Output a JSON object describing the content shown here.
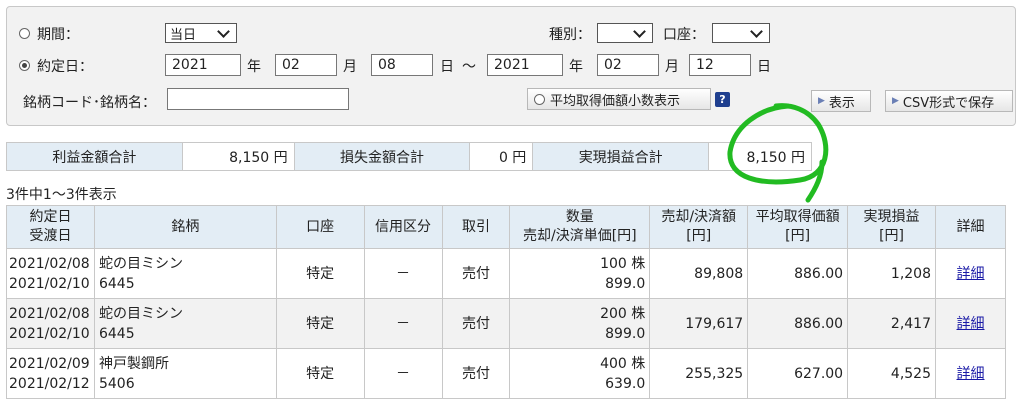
{
  "search": {
    "period_label": "期間：",
    "period_select": "当日",
    "trade_date_label": "約定日：",
    "from_year": "2021",
    "year_label": "年",
    "from_month": "02",
    "month_label": "月",
    "from_day": "08",
    "day_label": "日",
    "tilde": "～",
    "to_year": "2021",
    "to_month": "02",
    "to_day": "12",
    "type_label": "種別：",
    "type_select": "",
    "account_label": "口座：",
    "account_select": "",
    "code_label": "銘柄コード･銘柄名：",
    "code_value": "",
    "avg_decimal_label": "平均取得価額小数表示",
    "help_glyph": "?",
    "show_button": "表示",
    "csv_button": "CSV形式で保存"
  },
  "summary": {
    "profit_label": "利益金額合計",
    "profit_value": "8,150 円",
    "loss_label": "損失金額合計",
    "loss_value": "0 円",
    "realized_label": "実現損益合計",
    "realized_value": "8,150 円"
  },
  "count_text": "3件中1～3件表示",
  "table": {
    "headers": {
      "date1": "約定日",
      "date2": "受渡日",
      "stock": "銘柄",
      "account": "口座",
      "credit": "信用区分",
      "trade": "取引",
      "qty1": "数量",
      "qty2": "売却/決済単価[円]",
      "amount1": "売却/決済額",
      "amount2": "[円]",
      "avg1": "平均取得価額",
      "avg2": "[円]",
      "pl1": "実現損益",
      "pl2": "[円]",
      "detail": "詳細"
    },
    "rows": [
      {
        "trade_date": "2021/02/08",
        "settle_date": "2021/02/10",
        "name": "蛇の目ミシン",
        "code": "6445",
        "account": "特定",
        "credit": "－",
        "trade": "売付",
        "qty": "100 株",
        "price": "899.0",
        "amount": "89,808",
        "avg": "886.00",
        "pl": "1,208",
        "detail": "詳細"
      },
      {
        "trade_date": "2021/02/08",
        "settle_date": "2021/02/10",
        "name": "蛇の目ミシン",
        "code": "6445",
        "account": "特定",
        "credit": "－",
        "trade": "売付",
        "qty": "200 株",
        "price": "899.0",
        "amount": "179,617",
        "avg": "886.00",
        "pl": "2,417",
        "detail": "詳細"
      },
      {
        "trade_date": "2021/02/09",
        "settle_date": "2021/02/12",
        "name": "神戸製鋼所",
        "code": "5406",
        "account": "特定",
        "credit": "－",
        "trade": "売付",
        "qty": "400 株",
        "price": "639.0",
        "amount": "255,325",
        "avg": "627.00",
        "pl": "4,525",
        "detail": "詳細"
      }
    ]
  },
  "annotation": {
    "stroke_color": "#22bb22"
  }
}
